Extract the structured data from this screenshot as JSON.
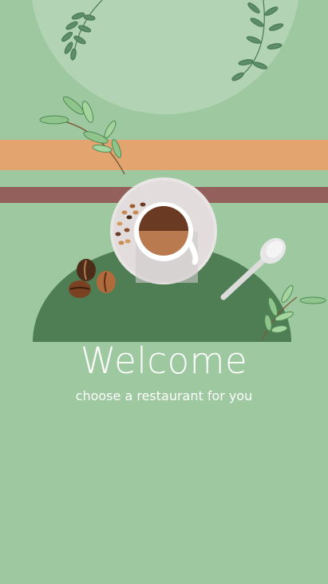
{
  "welcome": {
    "title": "Welcome",
    "subtitle": "choose a restaurant for you"
  },
  "illustration": {
    "icons": [
      "leaf-branch-icon",
      "coffee-cup-icon",
      "coffee-bean-icon",
      "spoon-icon"
    ]
  },
  "colors": {
    "background": "#9ec8a0",
    "circle": "#b2d4b5",
    "stripe_orange": "#e4a470",
    "stripe_brown": "#93605b",
    "dome": "#4f7e55",
    "text": "#ffffff"
  }
}
